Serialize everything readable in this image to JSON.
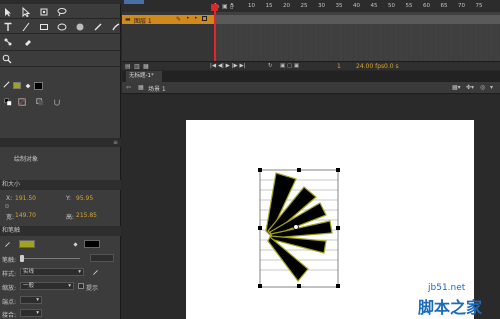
{
  "timeline": {
    "layer_name": "图层 1",
    "frame_ticks": [
      "1",
      "5",
      "10",
      "15",
      "20",
      "25",
      "30",
      "35",
      "40",
      "45",
      "50",
      "55",
      "60",
      "65",
      "70",
      "75"
    ],
    "current_frame": "1",
    "fps": "24.00 fps",
    "time": "0.0 s"
  },
  "document": {
    "tab_label": "无标题-1*",
    "scene_label": "场景 1"
  },
  "properties": {
    "object_type": "绘制对象",
    "position_section": "和大小",
    "x_label": "X:",
    "x_value": "191.50",
    "y_label": "Y:",
    "y_value": "95.95",
    "w_label": "宽:",
    "w_value": "149.70",
    "h_label": "高:",
    "h_value": "215.85",
    "fill_section": "和笔触",
    "stroke_label": "笔触:",
    "style_label": "样式:",
    "style_value": "实线",
    "scale_label": "缩放:",
    "scale_value": "一般",
    "hint_label": "提示",
    "cap_label": "端点:",
    "join_label": "接合:"
  },
  "colors": {
    "stroke_color": "#a3a31a",
    "fill_color": "#000000",
    "playhead": "#e0262a",
    "layer_highlight": "#d08a1b",
    "value_text": "#d9a62b"
  },
  "watermark": {
    "line1": "jb51.net",
    "line2": "脚本之家"
  }
}
